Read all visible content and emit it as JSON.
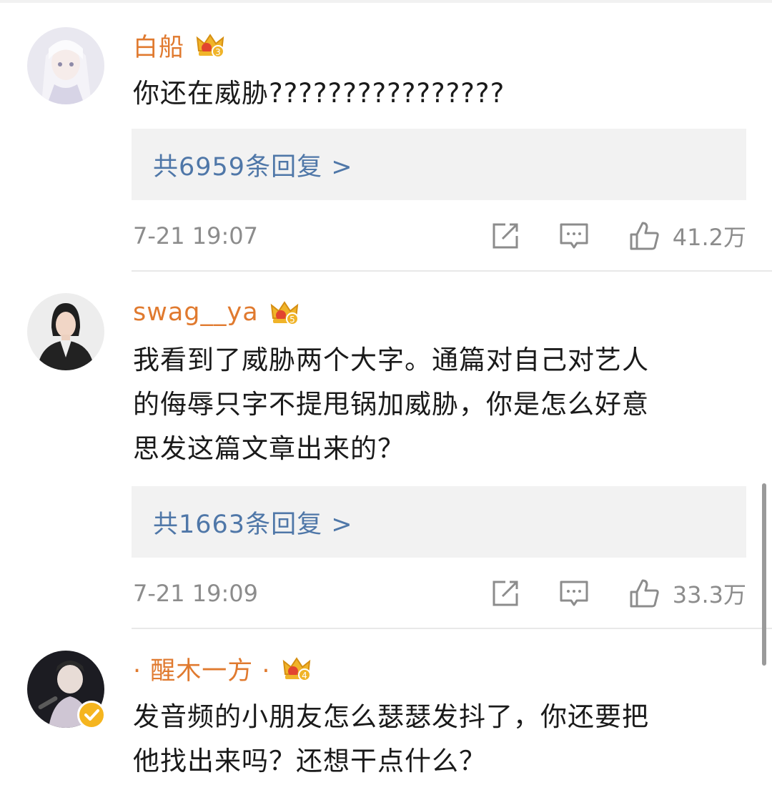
{
  "comments": [
    {
      "username": "白船",
      "crown_level": "3",
      "text": "你还在威胁????????????????",
      "replies_label": "共6959条回复 >",
      "time": "7-21 19:07",
      "likes": "41.2万",
      "verified": false
    },
    {
      "username": "swag__ya",
      "crown_level": "5",
      "text": "我看到了威胁两个大字。通篇对自己对艺人\n的侮辱只字不提甩锅加威胁，你是怎么好意\n思发这篇文章出来的？",
      "replies_label": "共1663条回复 >",
      "time": "7-21 19:09",
      "likes": "33.3万",
      "verified": false
    },
    {
      "username": "· 醒木一方 ·",
      "crown_level": "4",
      "text": "发音频的小朋友怎么瑟瑟发抖了，你还要把\n他找出来吗？还想干点什么？",
      "verified": true
    }
  ],
  "colors": {
    "username": "#e07a2f",
    "reply_link": "#4f77a8",
    "meta_text": "#8c8c8c",
    "crown": "#f0b429",
    "verified_badge": "#f5b51f"
  },
  "icons": {
    "crown": "crown-icon",
    "share": "share-icon",
    "reply": "comment-icon",
    "like": "thumbs-up-icon",
    "verified": "verified-badge-icon"
  }
}
